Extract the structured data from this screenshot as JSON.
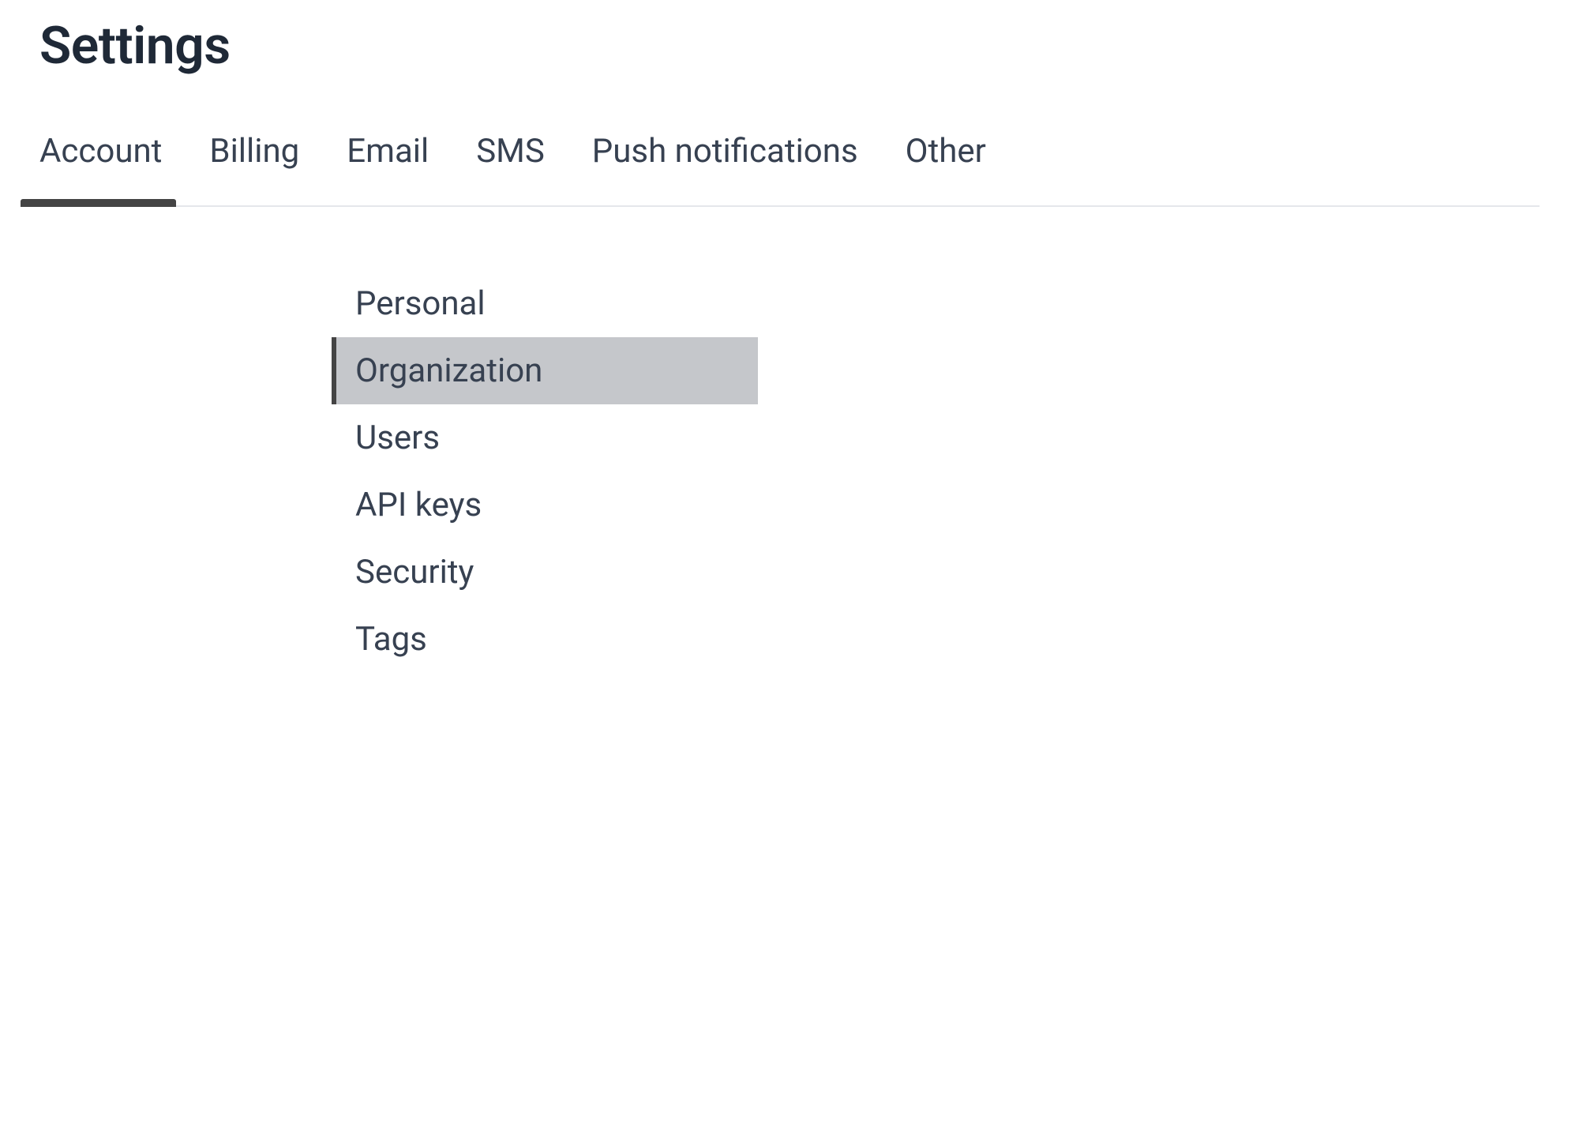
{
  "header": {
    "title": "Settings"
  },
  "tabs": [
    {
      "label": "Account",
      "active": true
    },
    {
      "label": "Billing",
      "active": false
    },
    {
      "label": "Email",
      "active": false
    },
    {
      "label": "SMS",
      "active": false
    },
    {
      "label": "Push notifications",
      "active": false
    },
    {
      "label": "Other",
      "active": false
    }
  ],
  "nav": {
    "items": [
      {
        "label": "Personal",
        "selected": false
      },
      {
        "label": "Organization",
        "selected": true
      },
      {
        "label": "Users",
        "selected": false
      },
      {
        "label": "API keys",
        "selected": false
      },
      {
        "label": "Security",
        "selected": false
      },
      {
        "label": "Tags",
        "selected": false
      }
    ]
  }
}
